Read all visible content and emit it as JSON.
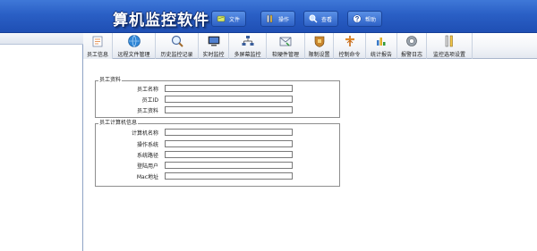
{
  "header": {
    "title": "算机监控软件",
    "buttons": [
      {
        "label": "文件",
        "icon": "file-icon"
      },
      {
        "label": "操作",
        "icon": "tools-icon"
      },
      {
        "label": "查看",
        "icon": "search-icon"
      },
      {
        "label": "帮助",
        "icon": "help-icon"
      }
    ]
  },
  "left_panel": {
    "header_label": ""
  },
  "toolbar": {
    "items": [
      {
        "label": "员工信息",
        "icon": "user-info-icon"
      },
      {
        "label": "远程文件管理",
        "icon": "globe-icon"
      },
      {
        "label": "历史监控记录",
        "icon": "magnifier-icon"
      },
      {
        "label": "实时监控",
        "icon": "monitor-icon"
      },
      {
        "label": "多屏幕监控",
        "icon": "network-icon"
      },
      {
        "label": "软硬件管理",
        "icon": "mail-icon"
      },
      {
        "label": "限制设置",
        "icon": "shield-icon"
      },
      {
        "label": "控制命令",
        "icon": "pin-icon"
      },
      {
        "label": "统计报告",
        "icon": "bar-chart-icon"
      },
      {
        "label": "报警日志",
        "icon": "alarm-icon"
      },
      {
        "label": "监控选项设置",
        "icon": "settings-tools-icon"
      }
    ]
  },
  "employee_group": {
    "legend": "员工资料",
    "fields": [
      {
        "label": "员工名称",
        "value": ""
      },
      {
        "label": "员工ID",
        "value": ""
      },
      {
        "label": "员工资料",
        "value": ""
      }
    ]
  },
  "computer_group": {
    "legend": "员工计算机信息",
    "fields": [
      {
        "label": "计算机名称",
        "value": ""
      },
      {
        "label": "操作系统",
        "value": ""
      },
      {
        "label": "系统路径",
        "value": ""
      },
      {
        "label": "登陆用户",
        "value": ""
      },
      {
        "label": "Mac地址",
        "value": ""
      }
    ]
  }
}
